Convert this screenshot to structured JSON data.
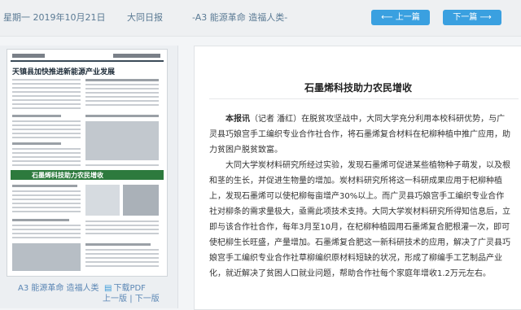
{
  "header": {
    "date": "星期一 2019年10月21日",
    "paper": "大同日报",
    "section": "-A3 能源革命 造福人类-",
    "prev_label": "上一篇",
    "next_label": "下一篇"
  },
  "sidebar": {
    "section_label": "A3 能源革命 造福人类",
    "pdf_label": "下载PDF",
    "prev_page": "上一版",
    "next_page": "下一版"
  },
  "thumbnail": {
    "headline_1": "天镇县加快推进新能源产业发展",
    "headline_2": "石墨烯科技助力农民增收"
  },
  "article": {
    "title": "石墨烯科技助力农民增收",
    "lead_tag": "本报讯",
    "lead_rest": "（记者 潘红）在脱贫攻坚战中，大同大学充分利用本校科研优势，与广灵县巧娘宫手工编织专业合作社合作，将石墨烯复合材料在杞柳种植中推广应用，助力贫困户脱贫致富。",
    "body": "大同大学炭材料研究所经过实验，发现石墨烯可促进某些植物种子萌发，以及根和茎的生长，并促进生物量的增加。炭材料研究所将这一科研成果应用于杞柳种植上，发现石墨烯可以使杞柳每亩增产30%以上。而广灵县巧娘宫手工编织专业合作社对柳条的需求量极大，亟需此项技术支持。大同大学炭材料研究所得知信息后，立即与该合作社合作，每年3月至10月，在杞柳种植园用石墨烯复合肥根灌一次，即可使杞柳生长旺盛，产量增加。石墨烯复合肥这一新科研技术的应用，解决了广灵县巧娘宫手工编织专业合作社草柳编织原材料短缺的状况，形成了柳编手工艺制品产业化，就近解决了贫困人口就业问题，帮助合作社每个家庭年增收1.2万元左右。"
  }
}
